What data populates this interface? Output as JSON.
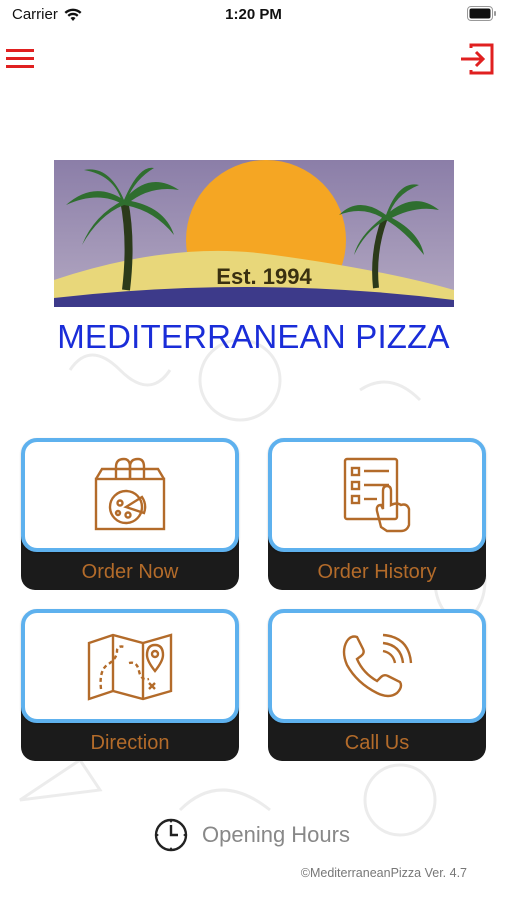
{
  "status_bar": {
    "carrier": "Carrier",
    "time": "1:20 PM"
  },
  "header": {
    "menu_icon": "hamburger-menu-icon",
    "logout_icon": "logout-icon",
    "accent": "#e02020"
  },
  "banner": {
    "est_text": "Est. 1994"
  },
  "brand": {
    "title": "MEDITERRANEAN PIZZA",
    "color": "#1a2dd8"
  },
  "tiles": [
    {
      "label": "Order Now",
      "icon": "pizza-bag-icon"
    },
    {
      "label": "Order History",
      "icon": "checklist-hand-icon"
    },
    {
      "label": "Direction",
      "icon": "map-pin-icon"
    },
    {
      "label": "Call Us",
      "icon": "phone-icon"
    }
  ],
  "footer": {
    "opening_hours": "Opening Hours",
    "version": "©MediterraneanPizza Ver. 4.7"
  }
}
